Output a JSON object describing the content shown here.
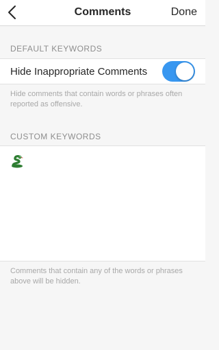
{
  "navbar": {
    "title": "Comments",
    "done_label": "Done",
    "back_icon": "chevron-left-icon"
  },
  "default_keywords": {
    "header": "DEFAULT KEYWORDS",
    "hide_label": "Hide Inappropriate Comments",
    "toggle_on": true,
    "toggle_color": "#3897f0",
    "description": "Hide comments that contain words or phrases often reported as offensive."
  },
  "custom_keywords": {
    "header": "CUSTOM KEYWORDS",
    "emoji_icon": "snake-icon",
    "value": "",
    "footnote": "Comments that contain any of the words or phrases above will be hidden."
  }
}
